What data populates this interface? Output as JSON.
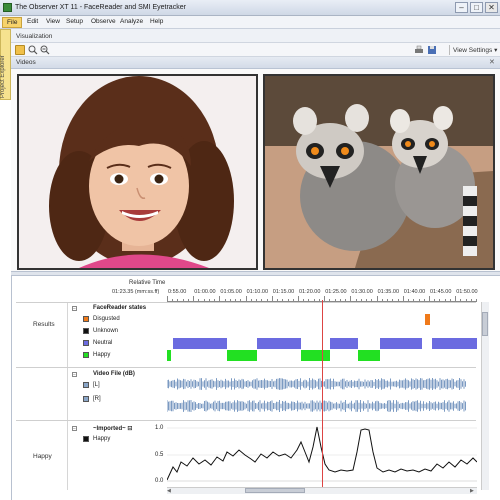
{
  "window": {
    "title": "The Observer XT 11 - FaceReader and SMI Eyetracker",
    "controls": {
      "minimize": "–",
      "maximize": "□",
      "close": "✕"
    }
  },
  "menu": {
    "items": [
      "File",
      "Edit",
      "View",
      "Setup",
      "Observe",
      "Analyze",
      "Help"
    ]
  },
  "side_tab": {
    "label": "Project Explorer"
  },
  "visualization": {
    "label": "Visualization"
  },
  "toolbar": {
    "view_settings": "View Settings",
    "view_settings_arrow": "▾",
    "icons": [
      "folder-icon",
      "zoom-in-icon",
      "zoom-out-icon",
      "print-icon",
      "save-icon"
    ]
  },
  "videos_panel": {
    "label": "Videos",
    "close_glyph": "✕",
    "left_video": "child-face-video",
    "right_video": "lemurs-video"
  },
  "timeline": {
    "relative_time_label": "Relative Time",
    "time_unit_label": "01:23.35 (mm:ss.ff)",
    "tick_labels": [
      "0:55.00",
      "01:00.00",
      "01:05.00",
      "01:10.00",
      "01:15.00",
      "01:20.00",
      "01:25.00",
      "01:30.00",
      "01:35.00",
      "01:40.00",
      "01:45.00",
      "01:50.00"
    ],
    "rows": [
      {
        "name": "Results",
        "group_title": "FaceReader states",
        "legend": [
          {
            "label": "Disgusted",
            "color": "#f07a1a"
          },
          {
            "label": "Unknown",
            "color": "#111111"
          },
          {
            "label": "Neutral",
            "color": "#6b6be0"
          },
          {
            "label": "Happy",
            "color": "#22e022"
          }
        ]
      },
      {
        "name": "",
        "group_title": "Video File (dB)",
        "legend": [
          {
            "label": "[L]",
            "color": "#8aa6c8"
          },
          {
            "label": "[R]",
            "color": "#8aa6c8"
          }
        ]
      },
      {
        "name": "Happy",
        "group_title": "~Imported~ ⊟",
        "legend": [
          {
            "label": "Happy",
            "color": "#111111"
          }
        ],
        "y_ticks": [
          "1.0",
          "0.5",
          "0.0"
        ]
      }
    ]
  },
  "colors": {
    "cursor": "#dd4444",
    "file_menu_highlight": "#f7d36b",
    "side_tab": "#f6e28f"
  }
}
